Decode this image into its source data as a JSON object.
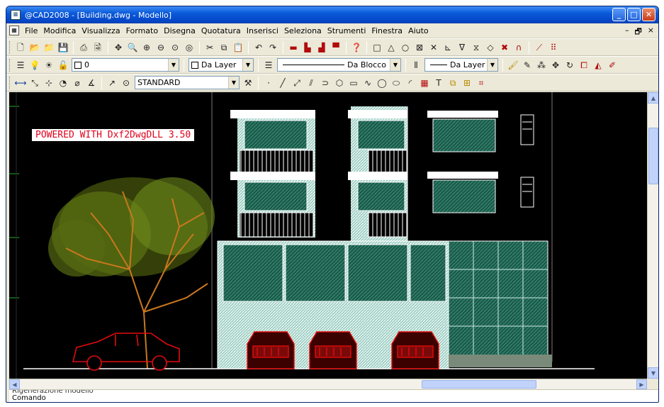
{
  "window": {
    "title": "@CAD2008 - [Building.dwg - Modello]",
    "app_icon": "cad-app-icon",
    "controls": [
      "_",
      "□",
      "✕"
    ]
  },
  "menu": {
    "items": [
      "File",
      "Modifica",
      "Visualizza",
      "Formato",
      "Disegna",
      "Quotatura",
      "Inserisci",
      "Seleziona",
      "Strumenti",
      "Finestra",
      "Aiuto"
    ],
    "mdi_controls": [
      "–",
      "🗗",
      "×"
    ]
  },
  "toolbar2": {
    "layer_value": "0",
    "color_value": "Da Layer",
    "linetype_value": "Da Blocco",
    "lineweight_value": "Da Layer"
  },
  "toolbar3": {
    "text_style_value": "STANDARD"
  },
  "drawing": {
    "watermark": "POWERED WITH Dxf2DwgDLL 3.50",
    "background": "#000000",
    "colors": {
      "building": "#ffffff",
      "glass": "#2d6f5c",
      "hatch": "#cfe9e2",
      "car": "#e30b0b",
      "tree": "#c8781e",
      "foliage": "#6e8c1a",
      "grid": "#1fae2a"
    }
  },
  "command": {
    "lines": [
      "Rigenerazione modello",
      "Comando"
    ]
  }
}
